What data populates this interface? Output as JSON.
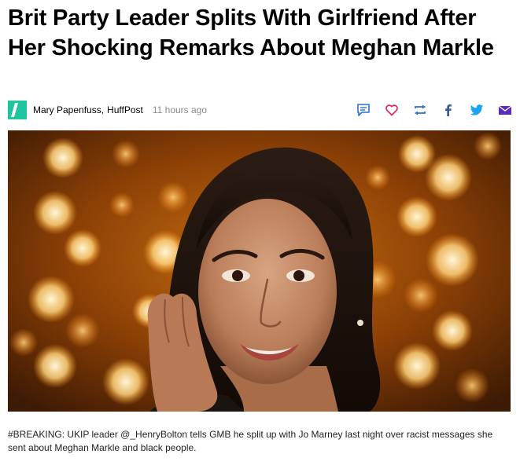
{
  "article": {
    "headline": "Brit Party Leader Splits With Girlfriend After Her Shocking Remarks About Meghan Markle"
  },
  "byline": {
    "author": "Mary Papenfuss,",
    "outlet": "HuffPost",
    "time": "11 hours ago"
  },
  "share": {
    "icons": [
      "comment-icon",
      "heart-icon",
      "repost-icon",
      "facebook-icon",
      "twitter-icon",
      "email-icon"
    ],
    "color_comment": "#2a6fd6",
    "color_heart": "#e0245e",
    "color_repost": "#2a6fd6",
    "color_facebook": "#3b5998",
    "color_twitter": "#1da1f2",
    "color_email": "#5b2bbf"
  },
  "logo": {
    "color": "#1fc59e"
  },
  "caption": {
    "text": "#BREAKING: UKIP leader @_HenryBolton tells GMB he split up with Jo Marney last night over racist messages she sent about Meghan Markle and black people."
  }
}
